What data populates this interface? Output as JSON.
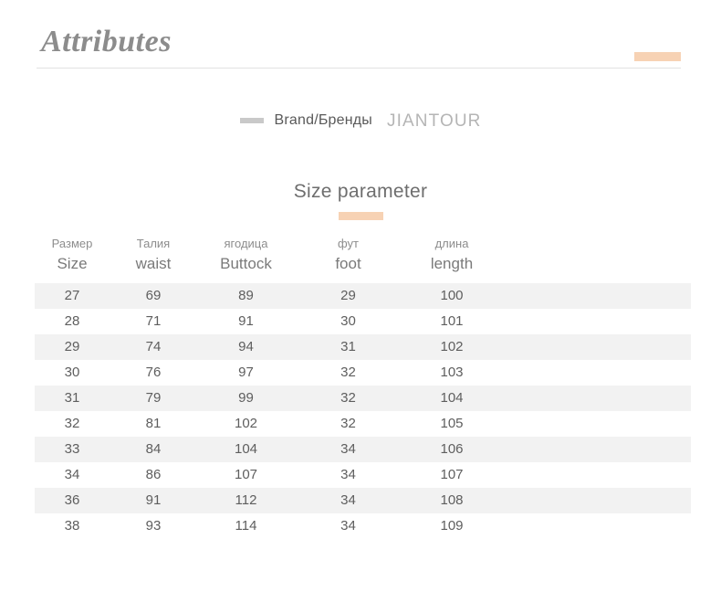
{
  "theme": {
    "accent": "#f7d2b4",
    "stripe": "#f2f2f2",
    "rule": "#e2e2e2",
    "text_dark": "#595959",
    "text_muted": "#8d8d8d",
    "text_light": "#b5b5b5"
  },
  "header": {
    "title": "Attributes"
  },
  "brand": {
    "label": "Brand/Бренды",
    "value": "JIANTOUR"
  },
  "section": {
    "title": "Size parameter"
  },
  "table": {
    "columns": [
      {
        "ru": "Размер",
        "en": "Size"
      },
      {
        "ru": "Талия",
        "en": "waist"
      },
      {
        "ru": "ягодица",
        "en": "Buttock"
      },
      {
        "ru": "фут",
        "en": "foot"
      },
      {
        "ru": "длина",
        "en": "length"
      }
    ],
    "rows": [
      [
        "27",
        "69",
        "89",
        "29",
        "100"
      ],
      [
        "28",
        "71",
        "91",
        "30",
        "101"
      ],
      [
        "29",
        "74",
        "94",
        "31",
        "102"
      ],
      [
        "30",
        "76",
        "97",
        "32",
        "103"
      ],
      [
        "31",
        "79",
        "99",
        "32",
        "104"
      ],
      [
        "32",
        "81",
        "102",
        "32",
        "105"
      ],
      [
        "33",
        "84",
        "104",
        "34",
        "106"
      ],
      [
        "34",
        "86",
        "107",
        "34",
        "107"
      ],
      [
        "36",
        "91",
        "112",
        "34",
        "108"
      ],
      [
        "38",
        "93",
        "114",
        "34",
        "109"
      ]
    ]
  }
}
